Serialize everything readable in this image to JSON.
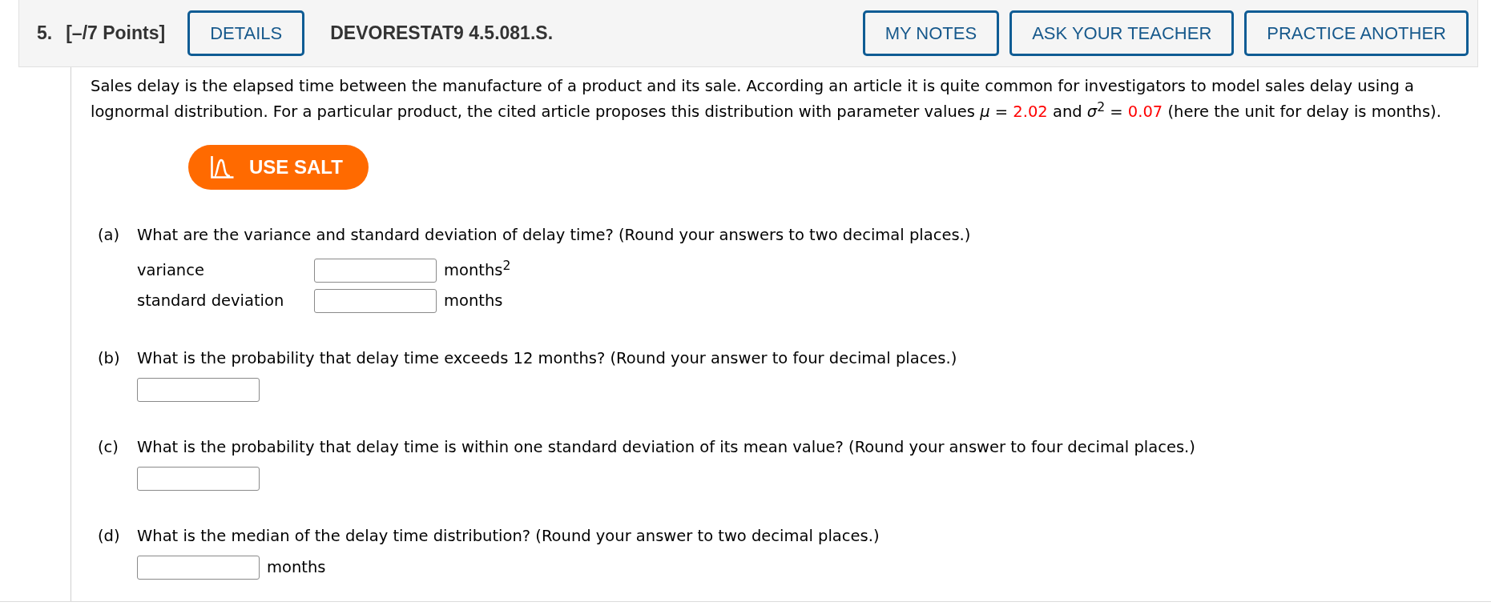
{
  "header": {
    "number": "5.",
    "points": "[–/7 Points]",
    "details_button": "DETAILS",
    "problem_id": "DEVORESTAT9 4.5.081.S.",
    "my_notes_button": "MY NOTES",
    "ask_teacher_button": "ASK YOUR TEACHER",
    "practice_another_button": "PRACTICE ANOTHER"
  },
  "problem": {
    "intro": [
      {
        "kind": "text",
        "text": "Sales delay is the elapsed time between the manufacture of a product and its sale. According an article it is quite common for investigators to model sales delay using a lognormal distribution. For a particular product, the cited article proposes this distribution with parameter values *μ* = "
      },
      {
        "kind": "value",
        "text": "2.02"
      },
      {
        "kind": "text",
        "text": " and *σ*$^{2}$ = "
      },
      {
        "kind": "value",
        "text": "0.07"
      },
      {
        "kind": "text",
        "text": " (here the unit for delay is months)."
      }
    ],
    "salt_button": "USE SALT"
  },
  "parts": [
    {
      "label": "(a)",
      "question": "What are the variance and standard deviation of delay time? (Round your answers to two decimal places.)",
      "answers": [
        {
          "kind": "labeled",
          "label": "variance",
          "unit": "months$^{2}$"
        },
        {
          "kind": "labeled",
          "label": "standard deviation",
          "unit": "months"
        }
      ]
    },
    {
      "label": "(b)",
      "question": "What is the probability that delay time exceeds 12 months? (Round your answer to four decimal places.)",
      "answers": [
        {
          "kind": "plain"
        }
      ]
    },
    {
      "label": "(c)",
      "question": "What is the probability that delay time is within one standard deviation of its mean value? (Round your answer to four decimal places.)",
      "answers": [
        {
          "kind": "plain"
        }
      ]
    },
    {
      "label": "(d)",
      "question": "What is the median of the delay time distribution? (Round your answer to two decimal places.)",
      "answers": [
        {
          "kind": "plain",
          "unit": "months"
        }
      ]
    }
  ]
}
